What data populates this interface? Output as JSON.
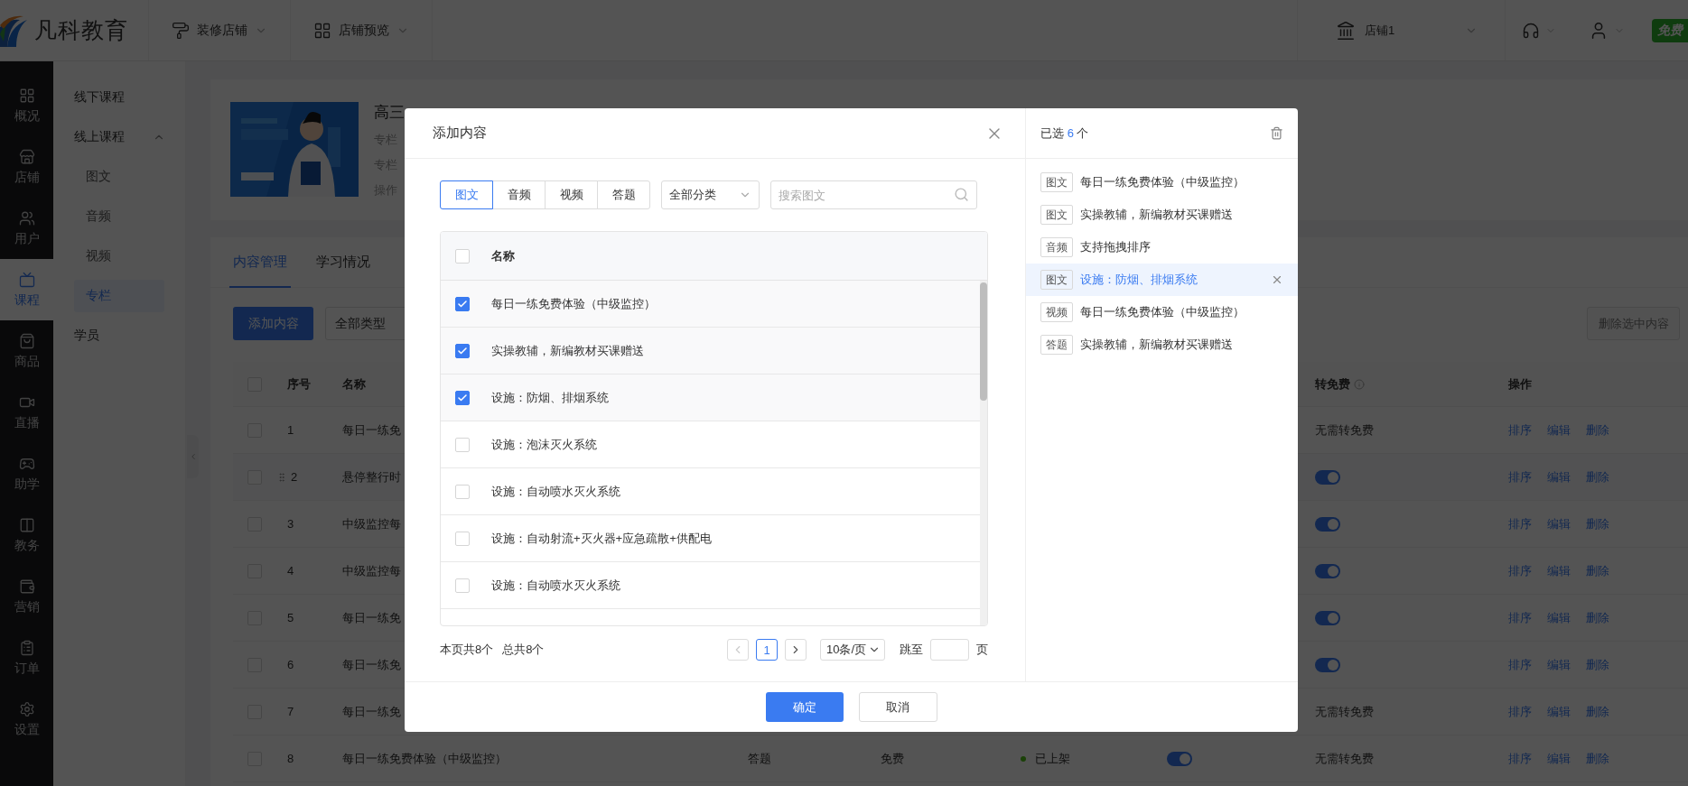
{
  "header": {
    "logo": "凡科教育",
    "menus": [
      {
        "label": "装修店铺"
      },
      {
        "label": "店铺预览"
      }
    ],
    "store": "店铺1",
    "badge": "免费"
  },
  "nav": [
    {
      "label": "概况",
      "selected": false
    },
    {
      "label": "店铺",
      "selected": false
    },
    {
      "label": "用户",
      "selected": false
    },
    {
      "label": "课程",
      "selected": true
    },
    {
      "label": "商品",
      "selected": false
    },
    {
      "label": "直播",
      "selected": false
    },
    {
      "label": "助学",
      "selected": false
    },
    {
      "label": "教务",
      "selected": false
    },
    {
      "label": "营销",
      "selected": false
    },
    {
      "label": "订单",
      "selected": false
    },
    {
      "label": "设置",
      "selected": false
    }
  ],
  "subnav": [
    {
      "label": "线下课程",
      "selected": false
    },
    {
      "label": "线上课程",
      "expanded": true,
      "children": [
        {
          "label": "图文",
          "selected": false
        },
        {
          "label": "音频",
          "selected": false
        },
        {
          "label": "视频",
          "selected": false
        },
        {
          "label": "专栏",
          "selected": true
        }
      ]
    },
    {
      "label": "学员",
      "selected": false
    }
  ],
  "course": {
    "title": "高三",
    "fields": [
      "专栏",
      "专栏",
      "操作"
    ]
  },
  "tabs": [
    {
      "label": "内容管理",
      "selected": true
    },
    {
      "label": "学习情况",
      "selected": false
    }
  ],
  "toolbar": {
    "add_button": "添加内容",
    "type_filter": "全部类型",
    "delete_button": "删除选中内容",
    "delete_disabled": true
  },
  "table": {
    "header_checked": false,
    "columns": [
      "序号",
      "名称",
      "转免费",
      "操作"
    ],
    "rows": [
      {
        "checked": false,
        "hovered": false,
        "index": "1",
        "name": "每日一练免",
        "free": {
          "kind": "text",
          "text": "无需转免费"
        },
        "actions": [
          "排序",
          "编辑",
          "删除"
        ]
      },
      {
        "checked": false,
        "hovered": true,
        "index": "2",
        "name": "悬停整行时",
        "free": {
          "kind": "switch",
          "on": true
        },
        "actions": [
          "排序",
          "编辑",
          "删除"
        ]
      },
      {
        "checked": false,
        "hovered": false,
        "index": "3",
        "name": "中级监控每",
        "free": {
          "kind": "switch",
          "on": true
        },
        "actions": [
          "排序",
          "编辑",
          "删除"
        ]
      },
      {
        "checked": false,
        "hovered": false,
        "index": "4",
        "name": "中级监控每",
        "free": {
          "kind": "switch",
          "on": true
        },
        "actions": [
          "排序",
          "编辑",
          "删除"
        ]
      },
      {
        "checked": false,
        "hovered": false,
        "index": "5",
        "name": "每日一练免",
        "free": {
          "kind": "switch",
          "on": true
        },
        "actions": [
          "排序",
          "编辑",
          "删除"
        ]
      },
      {
        "checked": false,
        "hovered": false,
        "index": "6",
        "name": "每日一练免",
        "free": {
          "kind": "switch",
          "on": true
        },
        "actions": [
          "排序",
          "编辑",
          "删除"
        ]
      },
      {
        "checked": false,
        "hovered": false,
        "index": "7",
        "name": "每日一练免",
        "free": {
          "kind": "text",
          "text": "无需转免费"
        },
        "actions": [
          "排序",
          "编辑",
          "删除"
        ]
      },
      {
        "checked": false,
        "hovered": false,
        "index": "8",
        "name": "每日一练免费体验（中级监控）",
        "type": "答题",
        "price": "免费",
        "status": "已上架",
        "listed": {
          "on": true
        },
        "free": {
          "kind": "text",
          "text": "无需转免费"
        },
        "actions": [
          "排序",
          "编辑",
          "删除"
        ]
      }
    ]
  },
  "modal": {
    "title": "添加内容",
    "type_tabs": [
      {
        "label": "图文",
        "selected": true
      },
      {
        "label": "音频",
        "selected": false
      },
      {
        "label": "视频",
        "selected": false
      },
      {
        "label": "答题",
        "selected": false
      }
    ],
    "category": "全部分类",
    "search_placeholder": "搜索图文",
    "list_header": {
      "label": "名称",
      "checked": false
    },
    "items": [
      {
        "name": "每日一练免费体验（中级监控）",
        "checked": true
      },
      {
        "name": "实操教辅，新编教材买课赠送",
        "checked": true
      },
      {
        "name": "设施：防烟、排烟系统",
        "checked": true
      },
      {
        "name": "设施：泡沫灭火系统",
        "checked": false
      },
      {
        "name": "设施：自动喷水灭火系统",
        "checked": false
      },
      {
        "name": "设施：自动射流+灭火器+应急疏散+供配电",
        "checked": false
      },
      {
        "name": "设施：自动喷水灭火系统",
        "checked": false
      }
    ],
    "page_summary": "本页共8个",
    "total": "总共8个",
    "pages": [
      {
        "label": "1",
        "selected": true
      }
    ],
    "page_size": "10条/页",
    "jump_label": "跳至",
    "page_unit": "页",
    "confirm": "确定",
    "cancel": "取消",
    "selected_panel": {
      "prefix": "已选",
      "count": "6",
      "suffix": "个",
      "items": [
        {
          "type": "图文",
          "title": "每日一练免费体验（中级监控）",
          "hovered": false
        },
        {
          "type": "图文",
          "title": "实操教辅，新编教材买课赠送",
          "hovered": false
        },
        {
          "type": "音频",
          "title": "支持拖拽排序",
          "hovered": false
        },
        {
          "type": "图文",
          "title": "设施：防烟、排烟系统",
          "hovered": true
        },
        {
          "type": "视频",
          "title": "每日一练免费体验（中级监控）",
          "hovered": false
        },
        {
          "type": "答题",
          "title": "实操教辅，新编教材买课赠送",
          "hovered": false
        }
      ]
    }
  }
}
